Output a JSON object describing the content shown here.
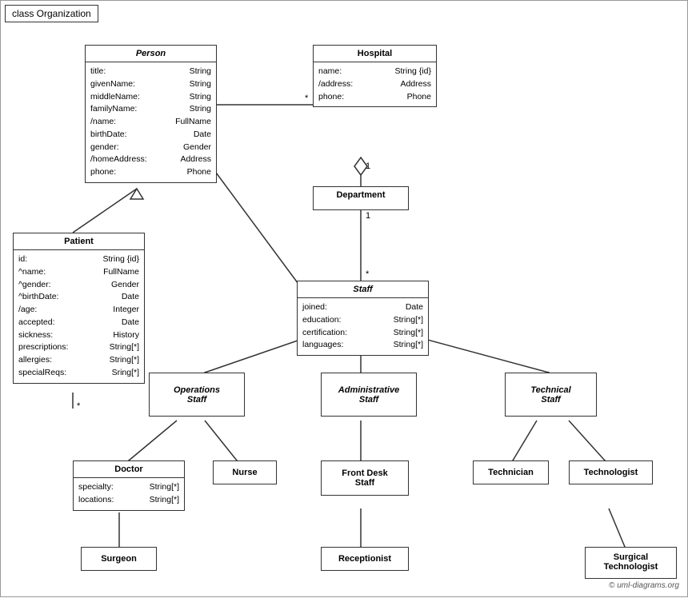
{
  "title": "class Organization",
  "copyright": "© uml-diagrams.org",
  "classes": {
    "person": {
      "name": "Person",
      "italic": true,
      "attrs": [
        {
          "name": "title:",
          "type": "String"
        },
        {
          "name": "givenName:",
          "type": "String"
        },
        {
          "name": "middleName:",
          "type": "String"
        },
        {
          "name": "familyName:",
          "type": "String"
        },
        {
          "name": "/name:",
          "type": "FullName"
        },
        {
          "name": "birthDate:",
          "type": "Date"
        },
        {
          "name": "gender:",
          "type": "Gender"
        },
        {
          "name": "/homeAddress:",
          "type": "Address"
        },
        {
          "name": "phone:",
          "type": "Phone"
        }
      ]
    },
    "hospital": {
      "name": "Hospital",
      "italic": false,
      "attrs": [
        {
          "name": "name:",
          "type": "String {id}"
        },
        {
          "name": "/address:",
          "type": "Address"
        },
        {
          "name": "phone:",
          "type": "Phone"
        }
      ]
    },
    "department": {
      "name": "Department",
      "italic": false,
      "attrs": []
    },
    "staff": {
      "name": "Staff",
      "italic": true,
      "attrs": [
        {
          "name": "joined:",
          "type": "Date"
        },
        {
          "name": "education:",
          "type": "String[*]"
        },
        {
          "name": "certification:",
          "type": "String[*]"
        },
        {
          "name": "languages:",
          "type": "String[*]"
        }
      ]
    },
    "patient": {
      "name": "Patient",
      "italic": false,
      "attrs": [
        {
          "name": "id:",
          "type": "String {id}"
        },
        {
          "name": "^name:",
          "type": "FullName"
        },
        {
          "name": "^gender:",
          "type": "Gender"
        },
        {
          "name": "^birthDate:",
          "type": "Date"
        },
        {
          "name": "/age:",
          "type": "Integer"
        },
        {
          "name": "accepted:",
          "type": "Date"
        },
        {
          "name": "sickness:",
          "type": "History"
        },
        {
          "name": "prescriptions:",
          "type": "String[*]"
        },
        {
          "name": "allergies:",
          "type": "String[*]"
        },
        {
          "name": "specialReqs:",
          "type": "Sring[*]"
        }
      ]
    },
    "operations_staff": {
      "name": "Operations Staff",
      "italic": true
    },
    "admin_staff": {
      "name": "Administrative Staff",
      "italic": true
    },
    "technical_staff": {
      "name": "Technical Staff",
      "italic": true
    },
    "doctor": {
      "name": "Doctor",
      "italic": false,
      "attrs": [
        {
          "name": "specialty:",
          "type": "String[*]"
        },
        {
          "name": "locations:",
          "type": "String[*]"
        }
      ]
    },
    "nurse": {
      "name": "Nurse",
      "italic": false,
      "attrs": []
    },
    "front_desk_staff": {
      "name": "Front Desk Staff",
      "italic": false,
      "attrs": []
    },
    "technician": {
      "name": "Technician",
      "italic": false,
      "attrs": []
    },
    "technologist": {
      "name": "Technologist",
      "italic": false,
      "attrs": []
    },
    "surgeon": {
      "name": "Surgeon",
      "italic": false,
      "attrs": []
    },
    "receptionist": {
      "name": "Receptionist",
      "italic": false,
      "attrs": []
    },
    "surgical_technologist": {
      "name": "Surgical Technologist",
      "italic": false,
      "attrs": []
    }
  }
}
